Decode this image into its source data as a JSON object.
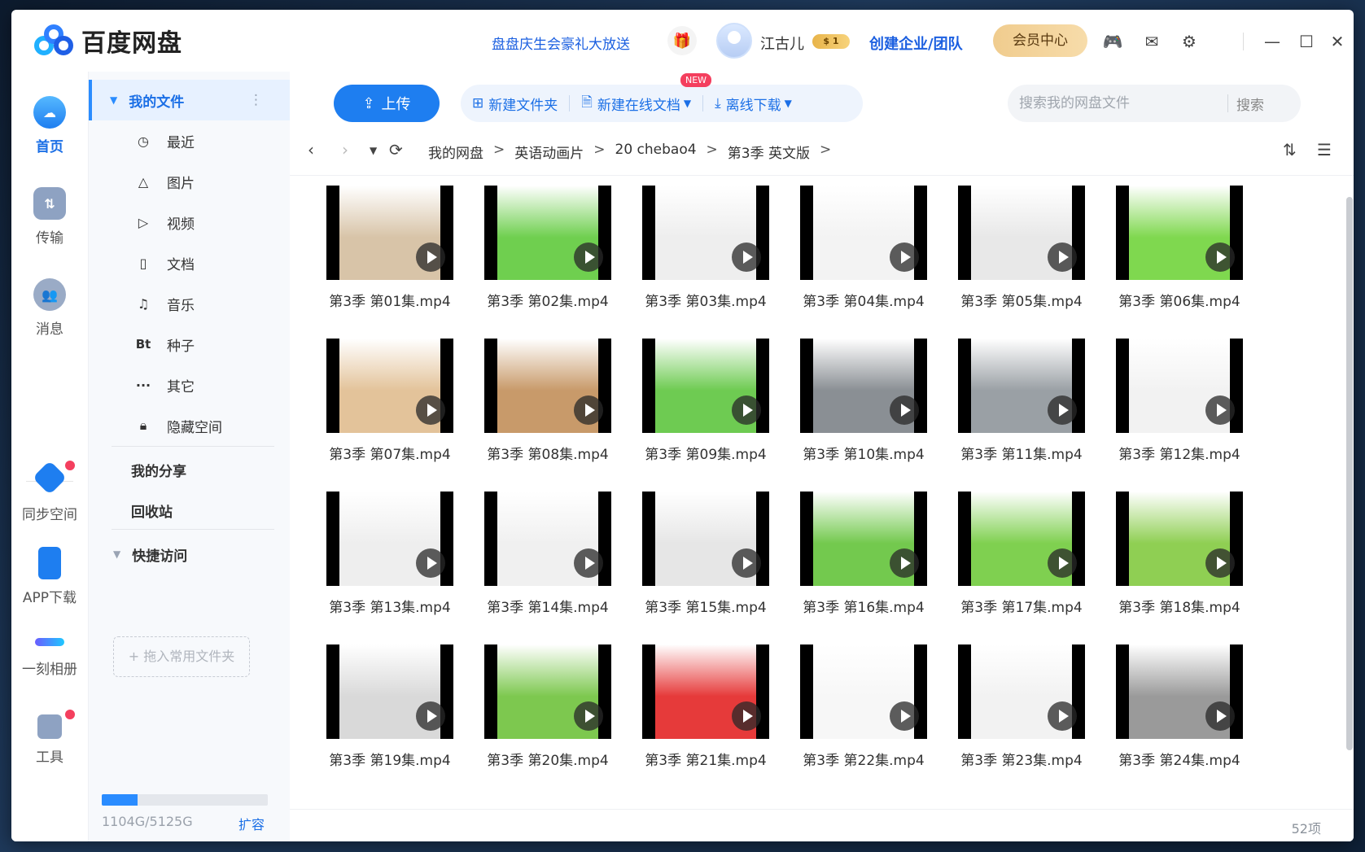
{
  "app": {
    "name": "百度网盘",
    "promo": "盘盘庆生会豪礼大放送",
    "username": "江古儿",
    "vip_badge": "$ 1",
    "create_team": "创建企业/团队",
    "vip_center": "会员中心"
  },
  "rail": {
    "home": "首页",
    "transfer": "传输",
    "messages": "消息",
    "sync": "同步空间",
    "app_download": "APP下载",
    "album": "一刻相册",
    "tools": "工具"
  },
  "sidebar": {
    "my_files": "我的文件",
    "recent": "最近",
    "images": "图片",
    "videos": "视频",
    "docs": "文档",
    "music": "音乐",
    "torrent_icon": "Bt",
    "torrent": "种子",
    "others": "其它",
    "hidden_space": "隐藏空间",
    "my_share": "我的分享",
    "recycle_bin": "回收站",
    "quick_access": "快捷访问",
    "drop_hint": "+ 拖入常用文件夹",
    "quota_used_fraction": 0.2154,
    "quota_text": "1104G/5125G",
    "expand": "扩容"
  },
  "toolbar": {
    "upload": "上传",
    "new_folder": "新建文件夹",
    "new_online_doc": "新建在线文档",
    "new_tag": "NEW",
    "offline_download": "离线下载",
    "search_placeholder": "搜索我的网盘文件",
    "search_button": "搜索"
  },
  "breadcrumb": [
    "我的网盘",
    "英语动画片",
    "20 chebao4",
    "第3季 英文版"
  ],
  "files": [
    {
      "name": "第3季 第01集.mp4",
      "bg": "#d8c4a8"
    },
    {
      "name": "第3季 第02集.mp4",
      "bg": "#6fcf4f"
    },
    {
      "name": "第3季 第03集.mp4",
      "bg": "#eeeeee"
    },
    {
      "name": "第3季 第04集.mp4",
      "bg": "#f3f3f3"
    },
    {
      "name": "第3季 第05集.mp4",
      "bg": "#e8e8e8"
    },
    {
      "name": "第3季 第06集.mp4",
      "bg": "#7fd84f"
    },
    {
      "name": "第3季 第07集.mp4",
      "bg": "#e3c39a"
    },
    {
      "name": "第3季 第08集.mp4",
      "bg": "#c89a6a"
    },
    {
      "name": "第3季 第09集.mp4",
      "bg": "#6ecb52"
    },
    {
      "name": "第3季 第10集.mp4",
      "bg": "#8a8f94"
    },
    {
      "name": "第3季 第11集.mp4",
      "bg": "#9aa0a5"
    },
    {
      "name": "第3季 第12集.mp4",
      "bg": "#f2f2f2"
    },
    {
      "name": "第3季 第13集.mp4",
      "bg": "#eeeeee"
    },
    {
      "name": "第3季 第14集.mp4",
      "bg": "#f0f0f0"
    },
    {
      "name": "第3季 第15集.mp4",
      "bg": "#e6e6e6"
    },
    {
      "name": "第3季 第16集.mp4",
      "bg": "#73c94e"
    },
    {
      "name": "第3季 第17集.mp4",
      "bg": "#7fd050"
    },
    {
      "name": "第3季 第18集.mp4",
      "bg": "#8fcf53"
    },
    {
      "name": "第3季 第19集.mp4",
      "bg": "#d9d9d9"
    },
    {
      "name": "第3季 第20集.mp4",
      "bg": "#7dc84f"
    },
    {
      "name": "第3季 第21集.mp4",
      "bg": "#e63a3a"
    },
    {
      "name": "第3季 第22集.mp4",
      "bg": "#f7f7f7"
    },
    {
      "name": "第3季 第23集.mp4",
      "bg": "#f2f2f2"
    },
    {
      "name": "第3季 第24集.mp4",
      "bg": "#9a9a9a"
    }
  ],
  "count": "52项"
}
